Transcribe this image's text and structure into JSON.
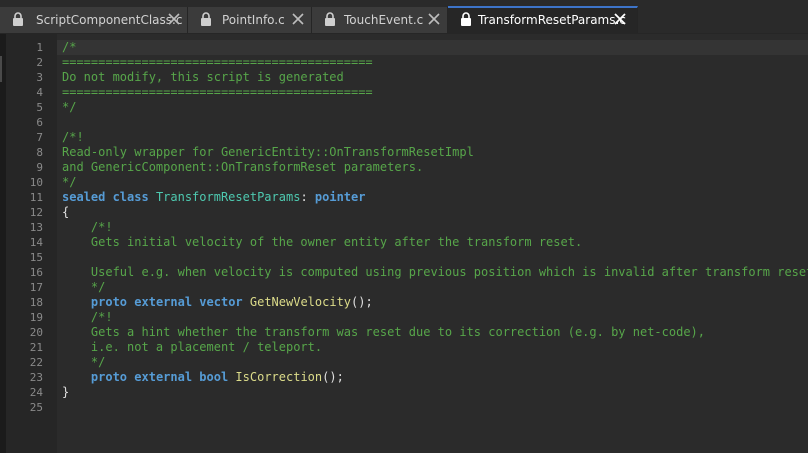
{
  "tabs": [
    {
      "label": "ScriptComponentClass.c",
      "active": false
    },
    {
      "label": "PointInfo.c",
      "active": false
    },
    {
      "label": "TouchEvent.c",
      "active": false
    },
    {
      "label": "TransformResetParams.c",
      "active": true
    }
  ],
  "icons": {
    "lock": "lock-icon",
    "close": "close-icon"
  },
  "colors": {
    "comment": "#57a64a",
    "keyword": "#569cd6",
    "type": "#4ec9b0",
    "function": "#dcdc8a",
    "plain": "#e0e0e0",
    "accent": "#3d74c9"
  },
  "editor": {
    "lines": [
      {
        "num": "1",
        "segs": [
          {
            "t": "c",
            "s": "/*"
          }
        ]
      },
      {
        "num": "2",
        "segs": [
          {
            "t": "c",
            "s": "==========================================="
          }
        ]
      },
      {
        "num": "3",
        "segs": [
          {
            "t": "c",
            "s": "Do not modify, this script is generated"
          }
        ]
      },
      {
        "num": "4",
        "segs": [
          {
            "t": "c",
            "s": "==========================================="
          }
        ]
      },
      {
        "num": "5",
        "segs": [
          {
            "t": "c",
            "s": "*/"
          }
        ]
      },
      {
        "num": "6",
        "segs": []
      },
      {
        "num": "7",
        "segs": [
          {
            "t": "c",
            "s": "/*!"
          }
        ]
      },
      {
        "num": "8",
        "segs": [
          {
            "t": "c",
            "s": "Read-only wrapper for GenericEntity::OnTransformResetImpl"
          }
        ]
      },
      {
        "num": "9",
        "segs": [
          {
            "t": "c",
            "s": "and GenericComponent::OnTransformReset parameters."
          }
        ]
      },
      {
        "num": "10",
        "segs": [
          {
            "t": "c",
            "s": "*/"
          }
        ]
      },
      {
        "num": "11",
        "segs": [
          {
            "t": "k",
            "s": "sealed "
          },
          {
            "t": "k",
            "s": "class "
          },
          {
            "t": "t",
            "s": "TransformResetParams"
          },
          {
            "t": "p",
            "s": ": "
          },
          {
            "t": "k",
            "s": "pointer"
          }
        ]
      },
      {
        "num": "12",
        "segs": [
          {
            "t": "p",
            "s": "{"
          }
        ]
      },
      {
        "num": "13",
        "segs": [
          {
            "t": "c",
            "s": "    /*!"
          }
        ]
      },
      {
        "num": "14",
        "segs": [
          {
            "t": "c",
            "s": "    Gets initial velocity of the owner entity after the transform reset."
          }
        ]
      },
      {
        "num": "15",
        "segs": []
      },
      {
        "num": "16",
        "segs": [
          {
            "t": "c",
            "s": "    Useful e.g. when velocity is computed using previous position which is invalid after transform reset."
          }
        ]
      },
      {
        "num": "17",
        "segs": [
          {
            "t": "c",
            "s": "    */"
          }
        ]
      },
      {
        "num": "18",
        "segs": [
          {
            "t": "p",
            "s": "    "
          },
          {
            "t": "k",
            "s": "proto "
          },
          {
            "t": "k",
            "s": "external "
          },
          {
            "t": "k",
            "s": "vector "
          },
          {
            "t": "f",
            "s": "GetNewVelocity"
          },
          {
            "t": "p",
            "s": "();"
          }
        ]
      },
      {
        "num": "19",
        "segs": [
          {
            "t": "c",
            "s": "    /*!"
          }
        ]
      },
      {
        "num": "20",
        "segs": [
          {
            "t": "c",
            "s": "    Gets a hint whether the transform was reset due to its correction (e.g. by net-code),"
          }
        ]
      },
      {
        "num": "21",
        "segs": [
          {
            "t": "c",
            "s": "    i.e. not a placement / teleport."
          }
        ]
      },
      {
        "num": "22",
        "segs": [
          {
            "t": "c",
            "s": "    */"
          }
        ]
      },
      {
        "num": "23",
        "segs": [
          {
            "t": "p",
            "s": "    "
          },
          {
            "t": "k",
            "s": "proto "
          },
          {
            "t": "k",
            "s": "external "
          },
          {
            "t": "k",
            "s": "bool "
          },
          {
            "t": "f",
            "s": "IsCorrection"
          },
          {
            "t": "p",
            "s": "();"
          }
        ]
      },
      {
        "num": "24",
        "segs": [
          {
            "t": "p",
            "s": "}"
          }
        ]
      },
      {
        "num": "25",
        "segs": []
      }
    ]
  }
}
